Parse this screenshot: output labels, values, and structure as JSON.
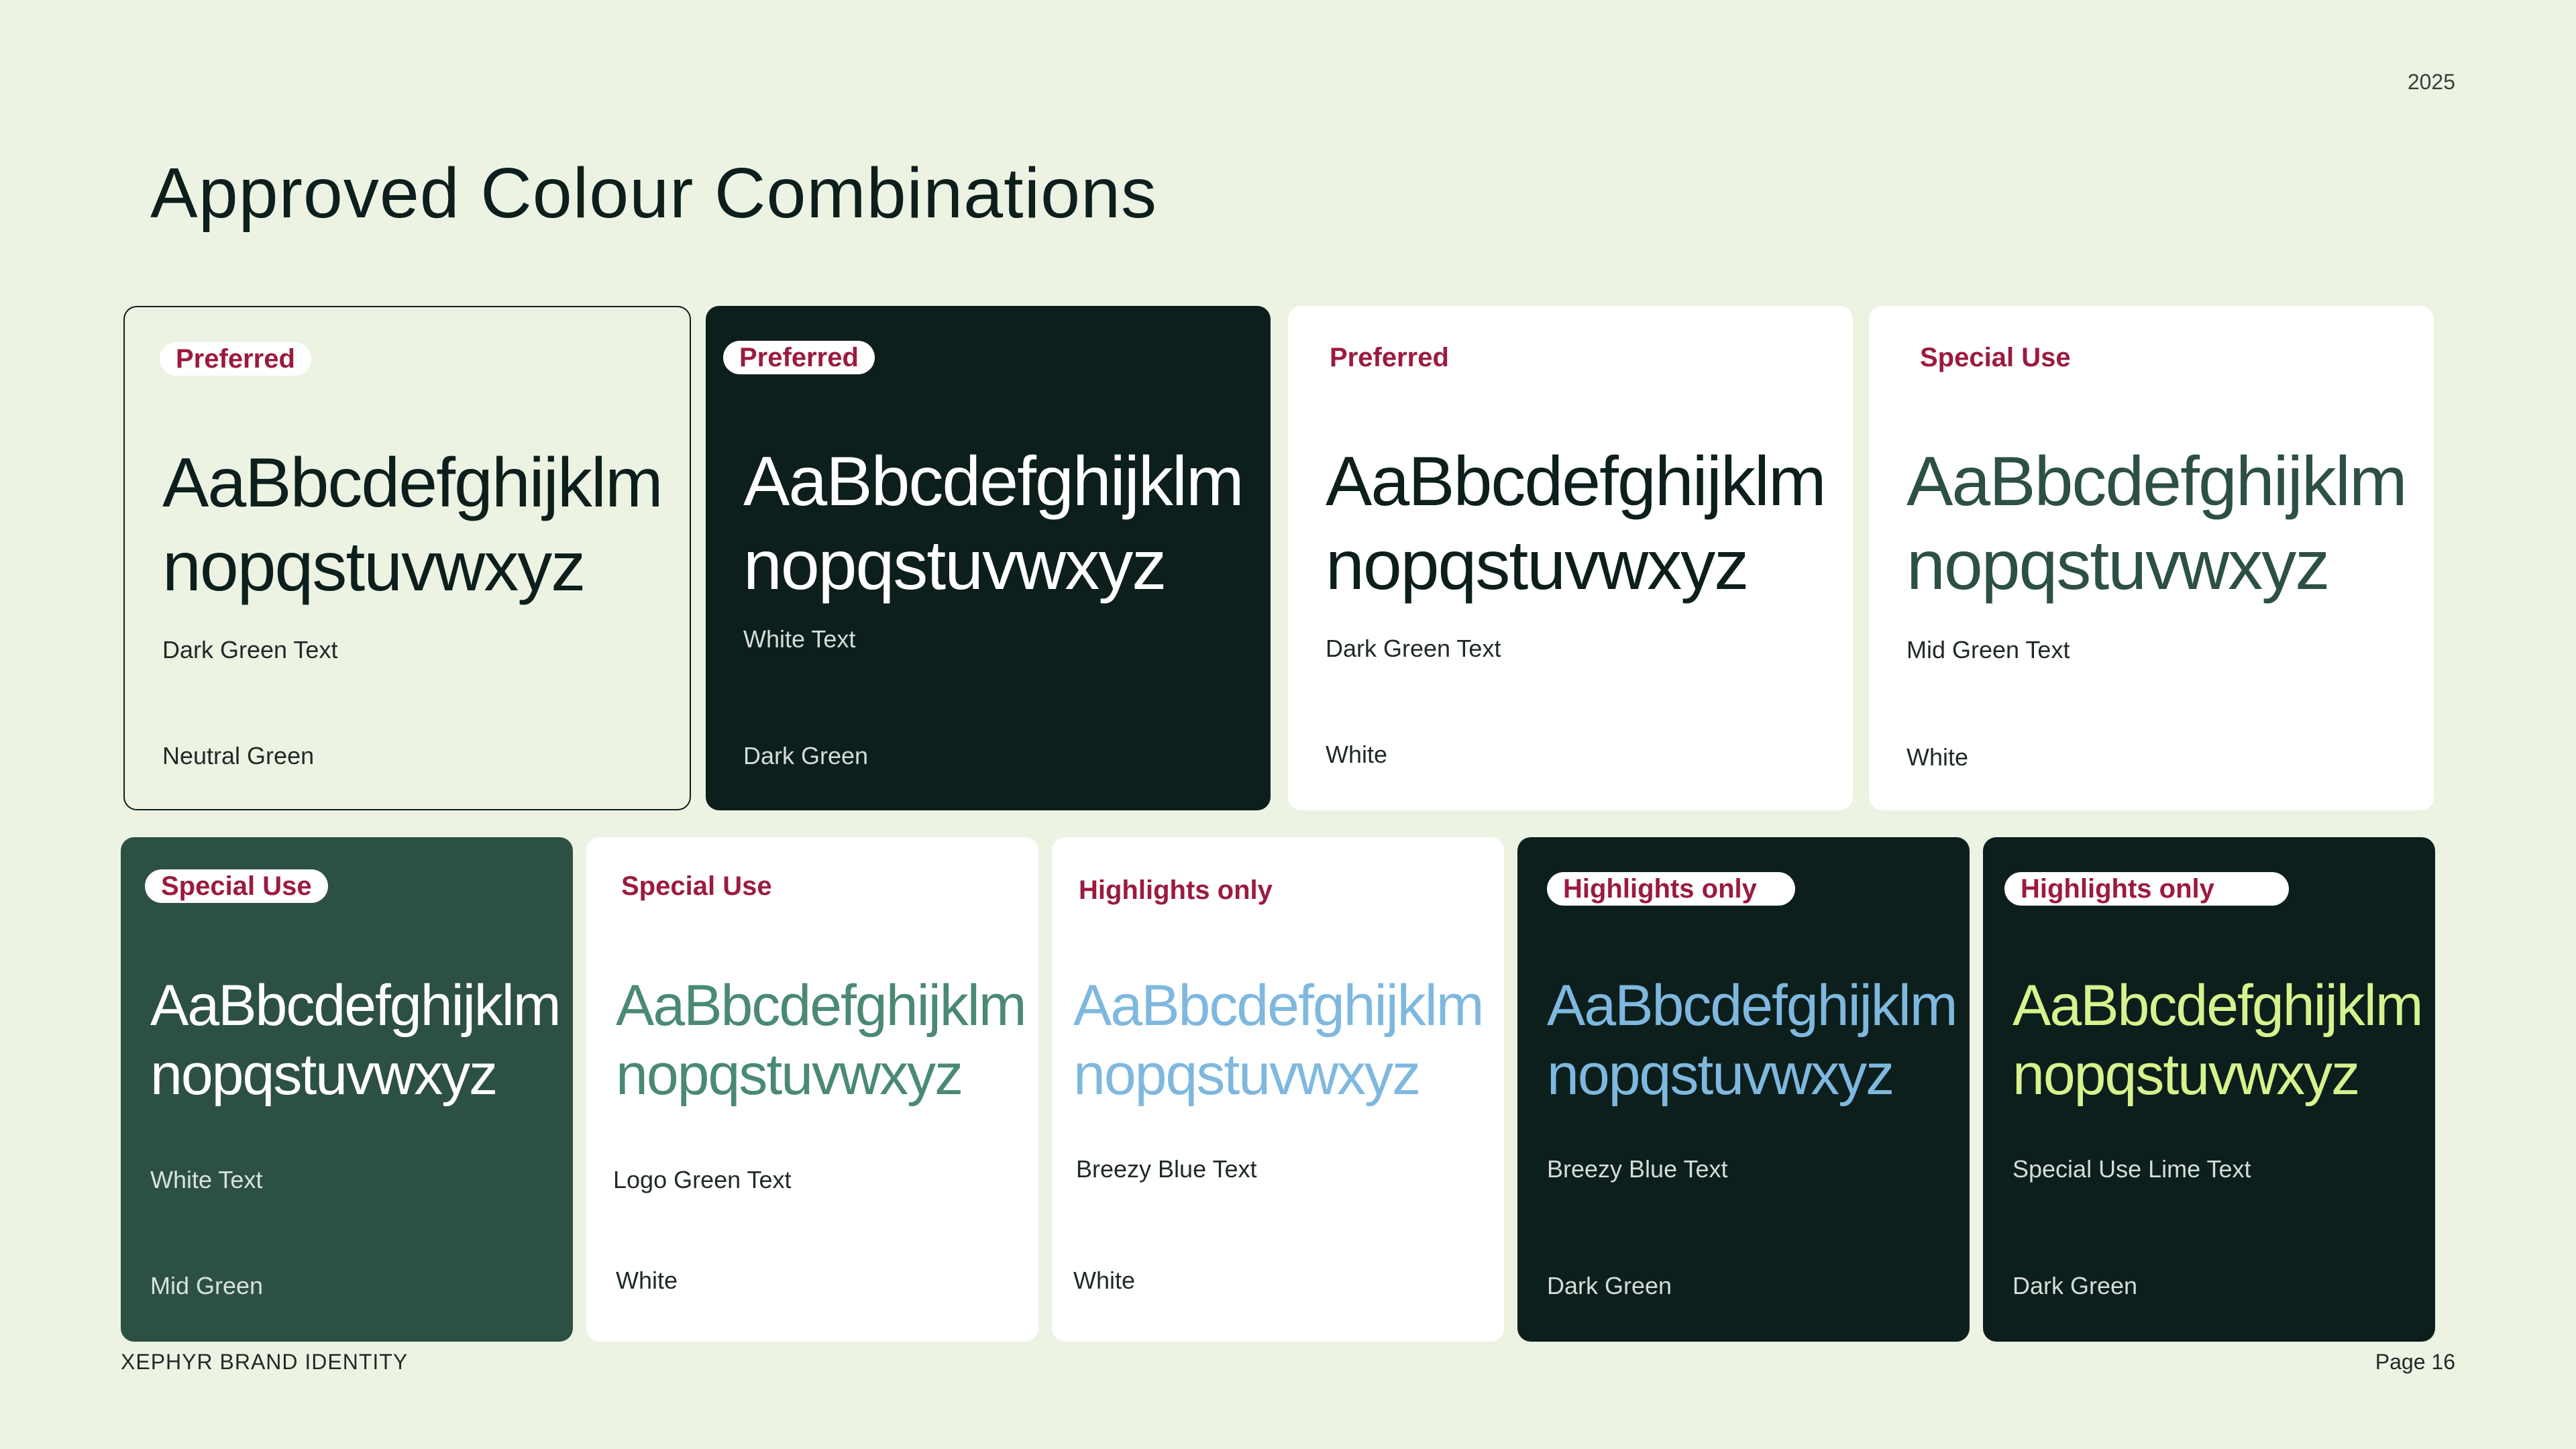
{
  "header": {
    "year": "2025",
    "title": "Approved Colour Combinations"
  },
  "footer": {
    "brand": "XEPHYR BRAND IDENTITY",
    "page": "Page 16"
  },
  "sample_text": {
    "line1": "AaBbcdefghijklm",
    "line2": "nopqstuvwxyz"
  },
  "colors": {
    "neutral_green": "#edf3e3",
    "dark_green": "#0c1f1c",
    "mid_green": "#2d5045",
    "logo_green": "#4a8a72",
    "breezy_blue": "#7fb8df",
    "special_lime": "#d8f28d",
    "white": "#ffffff",
    "badge_red": "#9b1b3e"
  },
  "cards": [
    {
      "badge": "Preferred",
      "text_label": "Dark Green Text",
      "bg_label": "Neutral Green"
    },
    {
      "badge": "Preferred",
      "text_label": "White Text",
      "bg_label": "Dark Green"
    },
    {
      "badge": "Preferred",
      "text_label": "Dark Green Text",
      "bg_label": "White"
    },
    {
      "badge": "Special Use",
      "text_label": "Mid Green Text",
      "bg_label": "White"
    },
    {
      "badge": "Special Use",
      "text_label": "White Text",
      "bg_label": "Mid Green"
    },
    {
      "badge": "Special Use",
      "text_label": "Logo Green Text",
      "bg_label": "White"
    },
    {
      "badge": "Highlights only",
      "text_label": "Breezy Blue Text",
      "bg_label": "White"
    },
    {
      "badge": "Highlights only",
      "text_label": "Breezy Blue Text",
      "bg_label": "Dark Green"
    },
    {
      "badge": "Highlights only",
      "text_label": "Special Use Lime Text",
      "bg_label": "Dark Green"
    }
  ]
}
